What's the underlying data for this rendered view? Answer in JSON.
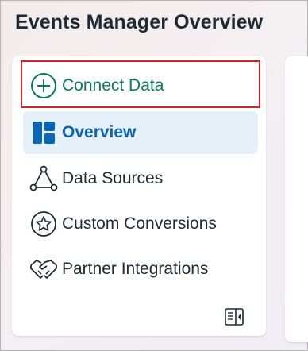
{
  "header": {
    "title": "Events Manager Overview"
  },
  "sidebar": {
    "items": [
      {
        "label": "Connect Data",
        "icon": "add-circle-icon"
      },
      {
        "label": "Overview",
        "icon": "dashboard-icon",
        "active": true
      },
      {
        "label": "Data Sources",
        "icon": "data-sources-network-icon"
      },
      {
        "label": "Custom Conversions",
        "icon": "star-badge-icon"
      },
      {
        "label": "Partner Integrations",
        "icon": "handshake-icon"
      }
    ],
    "collapse_icon": "collapse-sidebar-icon"
  },
  "colors": {
    "connect_green": "#0b7a57",
    "active_blue": "#0a66b4",
    "active_bg": "#e6f0f8",
    "highlight_red": "#d5202f"
  }
}
